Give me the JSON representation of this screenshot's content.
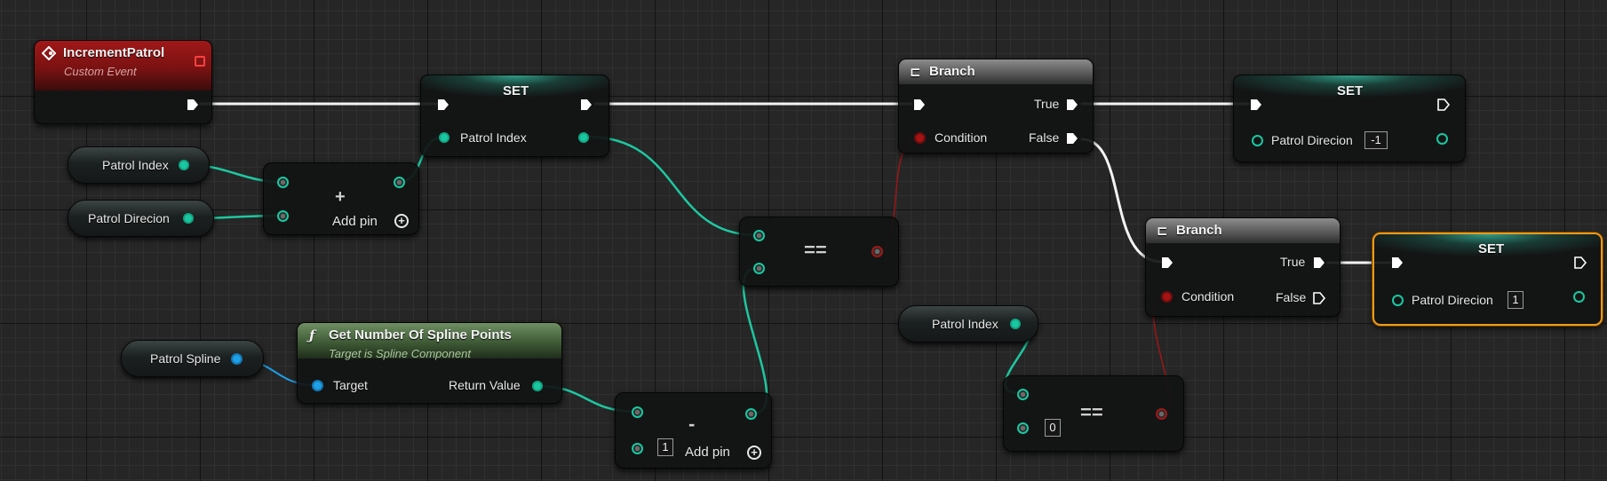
{
  "colors": {
    "exec_wire": "#ffffff",
    "integer_wire": "#1ec8a0",
    "boolean_wire": "#a01818",
    "object_wire": "#1e9ee8",
    "selection": "#f29a16"
  },
  "nodes": {
    "increment_patrol": {
      "title": "IncrementPatrol",
      "subtitle": "Custom Event"
    },
    "patrol_index_get_1": {
      "label": "Patrol Index"
    },
    "patrol_direcion_get": {
      "label": "Patrol Direcion"
    },
    "add_node": {
      "symbol": "+",
      "add_pin": "Add pin"
    },
    "set_1": {
      "title": "SET",
      "pin": "Patrol Index"
    },
    "equals_1": {
      "symbol": "=="
    },
    "patrol_spline_get": {
      "label": "Patrol Spline"
    },
    "get_spline_points": {
      "title": "Get Number Of Spline Points",
      "subtitle": "Target is Spline Component",
      "target": "Target",
      "return": "Return Value"
    },
    "subtract_node": {
      "symbol": "-",
      "value": "1",
      "add_pin": "Add pin"
    },
    "branch_1": {
      "title": "Branch",
      "condition": "Condition",
      "true_label": "True",
      "false_label": "False"
    },
    "set_2": {
      "title": "SET",
      "pin": "Patrol Direcion",
      "value": "-1"
    },
    "branch_2": {
      "title": "Branch",
      "condition": "Condition",
      "true_label": "True",
      "false_label": "False"
    },
    "set_3": {
      "title": "SET",
      "pin": "Patrol Direcion",
      "value": "1"
    },
    "patrol_index_get_2": {
      "label": "Patrol Index"
    },
    "equals_2": {
      "symbol": "==",
      "value": "0"
    }
  }
}
